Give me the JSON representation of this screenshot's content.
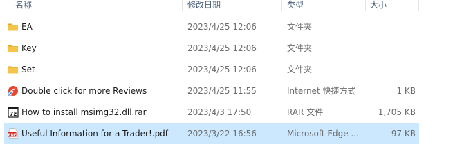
{
  "columns": {
    "name": "名称",
    "date": "修改日期",
    "type": "类型",
    "size": "大小"
  },
  "files": [
    {
      "name": "EA",
      "date": "2023/4/25 12:06",
      "type": "文件夹",
      "size": "",
      "icon": "folder-icon"
    },
    {
      "name": "Key",
      "date": "2023/4/25 12:06",
      "type": "文件夹",
      "size": "",
      "icon": "folder-icon"
    },
    {
      "name": "Set",
      "date": "2023/4/25 12:06",
      "type": "文件夹",
      "size": "",
      "icon": "folder-icon"
    },
    {
      "name": "Double click for more Reviews",
      "date": "2023/4/25 11:55",
      "type": "Internet 快捷方式",
      "size": "1 KB",
      "icon": "internet-shortcut-icon"
    },
    {
      "name": "How to install msimg32.dll.rar",
      "date": "2023/4/3 17:50",
      "type": "RAR 文件",
      "size": "1,705 KB",
      "icon": "rar-archive-icon"
    },
    {
      "name": "Useful Information for a Trader!.pdf",
      "date": "2023/3/22 16:56",
      "type": "Microsoft Edge ...",
      "size": "97 KB",
      "icon": "pdf-file-icon",
      "selected": true
    }
  ],
  "colors": {
    "selection": "#cce8ff",
    "folder": "#f5c44a",
    "header_text": "#4c607a"
  }
}
